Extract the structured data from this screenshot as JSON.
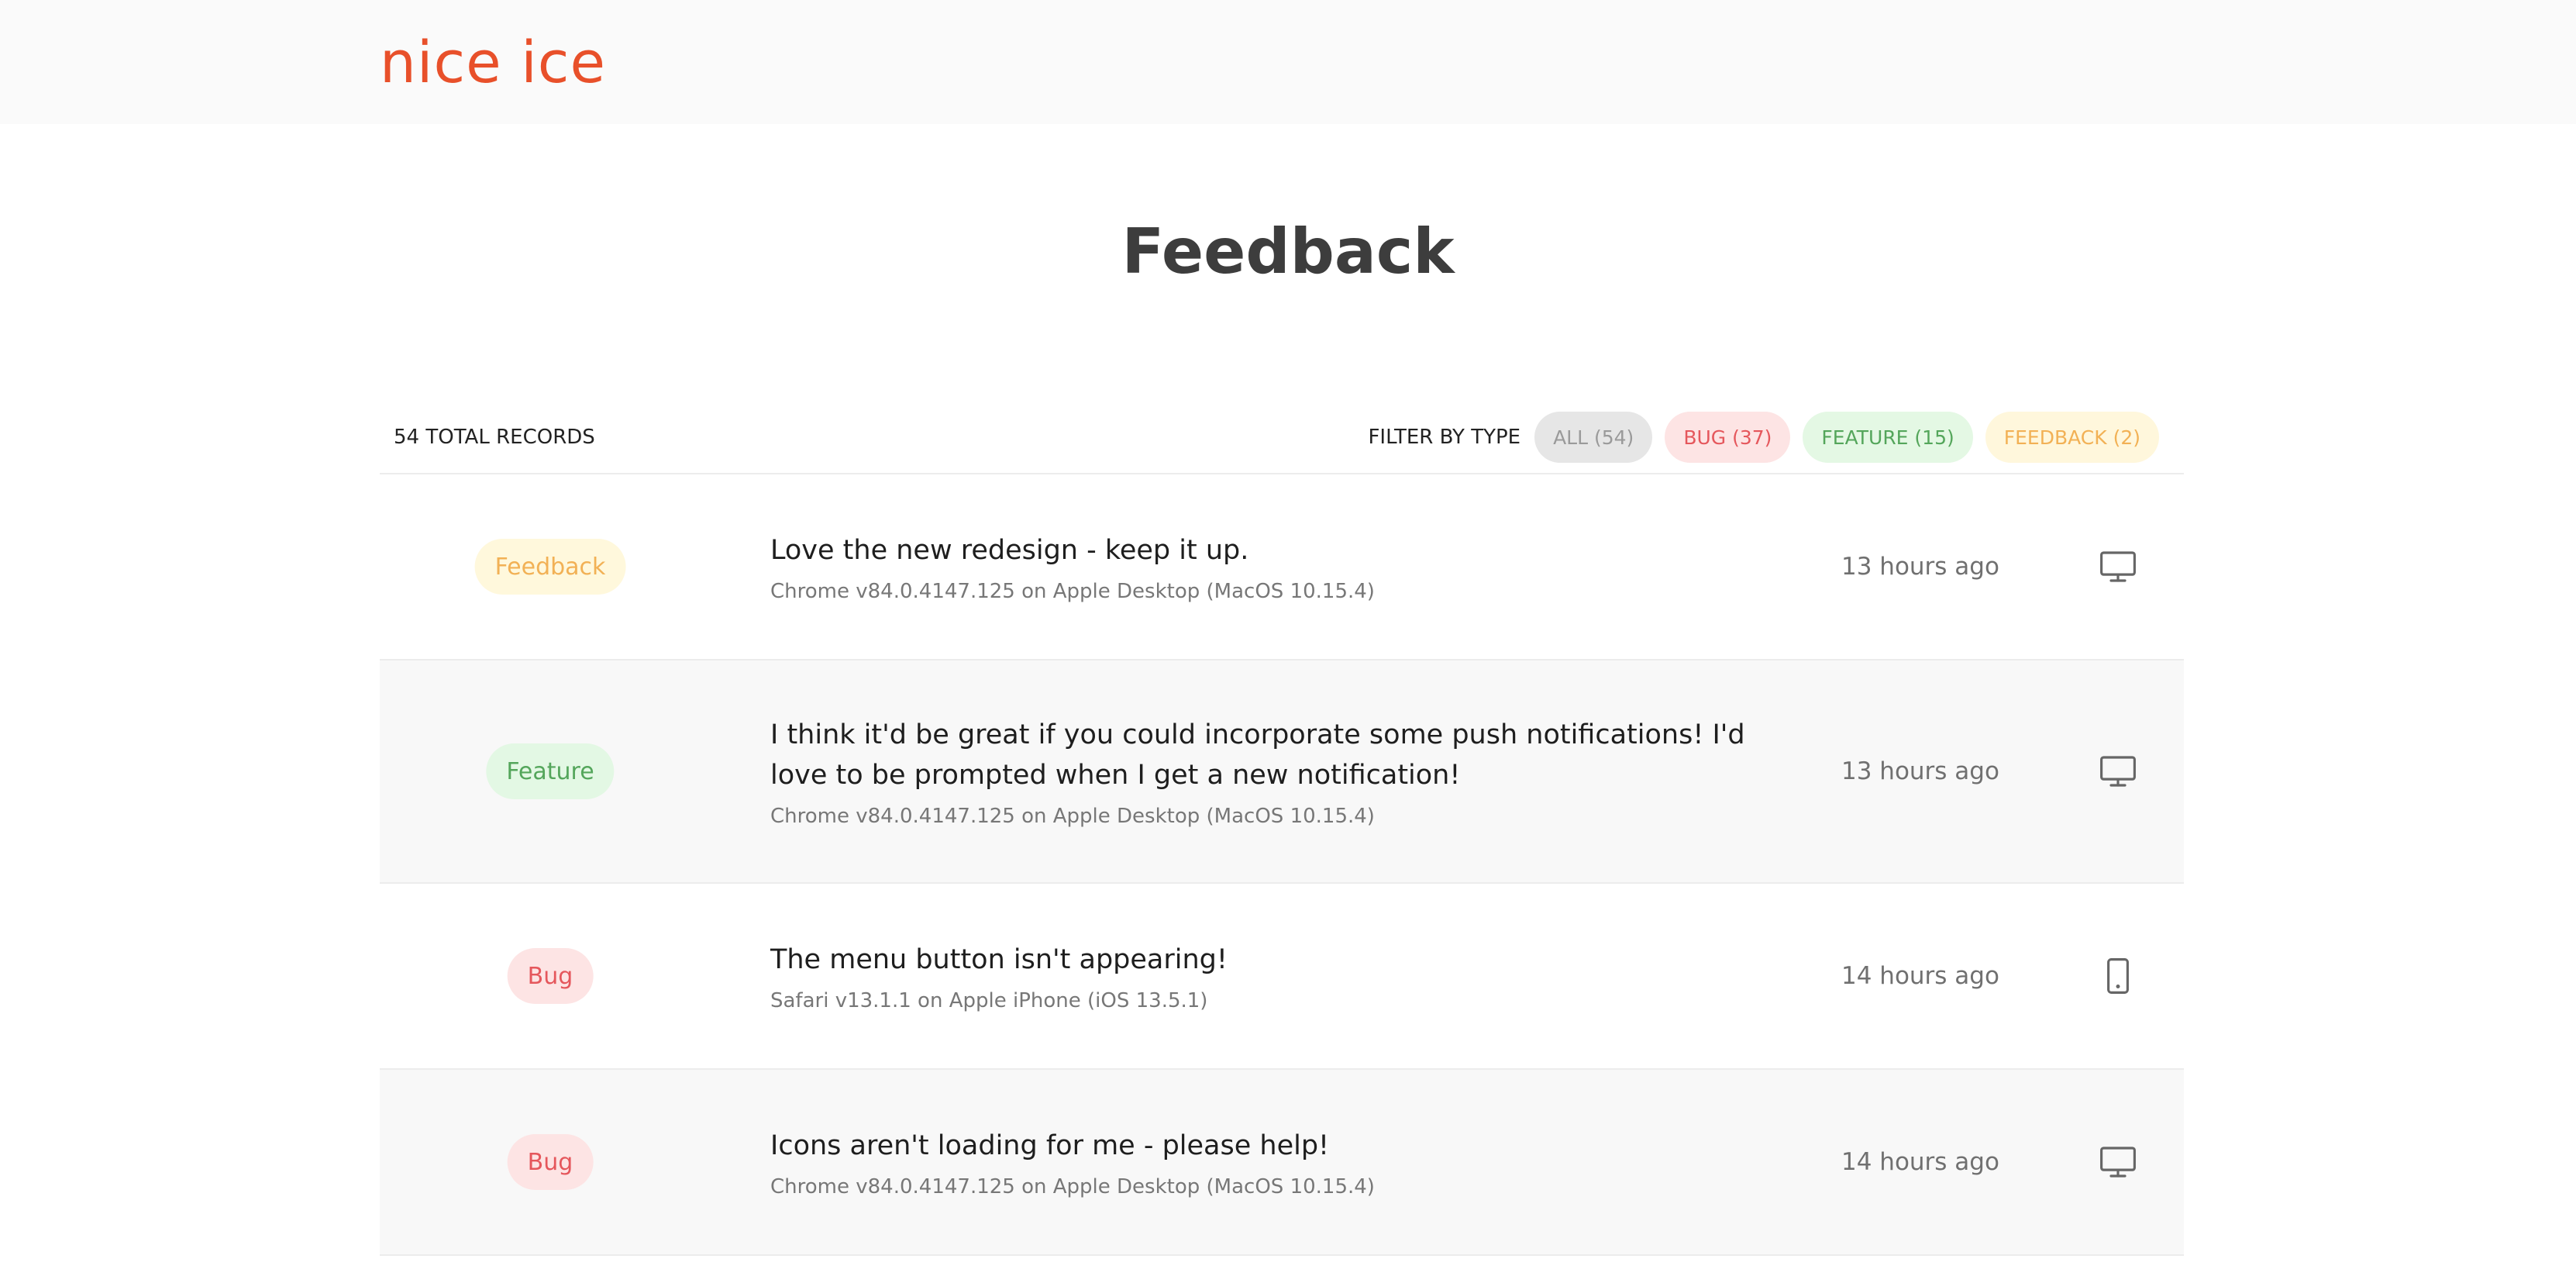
{
  "header": {
    "brand": "nice ice"
  },
  "page": {
    "title": "Feedback"
  },
  "toolbar": {
    "total_records": "54 TOTAL RECORDS",
    "filter_label": "FILTER BY TYPE",
    "filters": [
      {
        "label": "ALL (54)",
        "key": "all"
      },
      {
        "label": "BUG (37)",
        "key": "bug"
      },
      {
        "label": "FEATURE (15)",
        "key": "feature"
      },
      {
        "label": "FEEDBACK (2)",
        "key": "feedback"
      }
    ]
  },
  "records": [
    {
      "type": "Feedback",
      "message": "Love the new redesign - keep it up.",
      "meta": "Chrome v84.0.4147.125 on Apple Desktop (MacOS 10.15.4)",
      "time": "13 hours ago",
      "device_icon": "desktop-icon"
    },
    {
      "type": "Feature",
      "message": "I think it'd be great if you could incorporate some push notifications! I'd love to be prompted when I get a new notification!",
      "meta": "Chrome v84.0.4147.125 on Apple Desktop (MacOS 10.15.4)",
      "time": "13 hours ago",
      "device_icon": "desktop-icon"
    },
    {
      "type": "Bug",
      "message": "The menu button isn't appearing!",
      "meta": "Safari v13.1.1 on Apple iPhone (iOS 13.5.1)",
      "time": "14 hours ago",
      "device_icon": "mobile-icon"
    },
    {
      "type": "Bug",
      "message": "Icons aren't loading for me - please help!",
      "meta": "Chrome v84.0.4147.125 on Apple Desktop (MacOS 10.15.4)",
      "time": "14 hours ago",
      "device_icon": "desktop-icon"
    }
  ],
  "colors": {
    "brand": "#e8502a",
    "bug": "#e5575c",
    "feature": "#54a65b",
    "feedback": "#f2b155"
  }
}
